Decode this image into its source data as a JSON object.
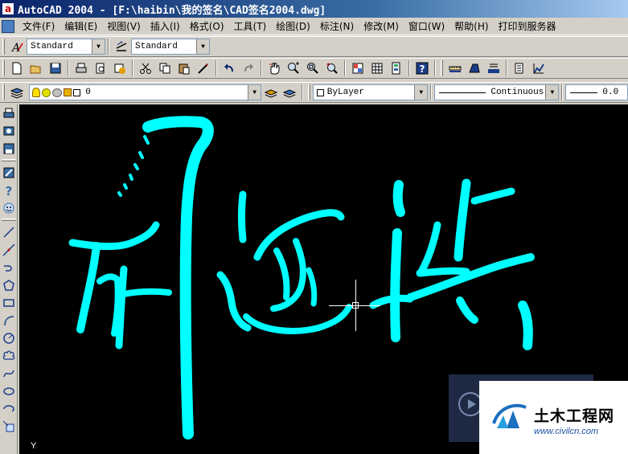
{
  "window": {
    "title": "AutoCAD 2004 - [F:\\haibin\\我的签名\\CAD签名2004.dwg]",
    "app_icon": "a"
  },
  "menu": {
    "items": [
      "文件(F)",
      "编辑(E)",
      "视图(V)",
      "插入(I)",
      "格式(O)",
      "工具(T)",
      "绘图(D)",
      "标注(N)",
      "修改(M)",
      "窗口(W)",
      "帮助(H)",
      "打印到服务器"
    ]
  },
  "styles_toolbar": {
    "text_style": "Standard",
    "dim_style": "Standard"
  },
  "standard_toolbar": {
    "icons": [
      "new-icon",
      "open-icon",
      "save-icon",
      "print-icon",
      "print-preview-icon",
      "publish-icon",
      "cut-icon",
      "copy-icon",
      "paste-icon",
      "match-properties-icon",
      "undo-icon",
      "redo-icon",
      "pan-icon",
      "zoom-realtime-icon",
      "zoom-window-icon",
      "zoom-previous-icon",
      "properties-icon",
      "design-center-icon",
      "tool-palettes-icon",
      "help-icon",
      "dist-icon",
      "area-icon",
      "list-icon",
      "id-icon",
      "locate-icon"
    ]
  },
  "layers_toolbar": {
    "current_layer": "0",
    "color": "ByLayer",
    "linetype": "Continuous",
    "lineweight": "0.0"
  },
  "draw_toolbar": {
    "icons": [
      "print-icon",
      "publish-icon",
      "save-icon",
      "dbconnect-icon",
      "help-icon",
      "smiley-icon",
      "line-icon",
      "construction-line-icon",
      "polyline-icon",
      "polygon-icon",
      "rectangle-icon",
      "arc-icon",
      "circle-icon",
      "revision-cloud-icon",
      "spline-icon",
      "ellipse-icon",
      "ellipse-arc-icon",
      "insert-block-icon"
    ]
  },
  "canvas": {
    "background": "#000000",
    "stroke_color": "#00ffff",
    "ucs_axis": "Y"
  },
  "watermark": {
    "brand_cn": "土木工程网",
    "brand_url": "www.civilcn.com"
  }
}
